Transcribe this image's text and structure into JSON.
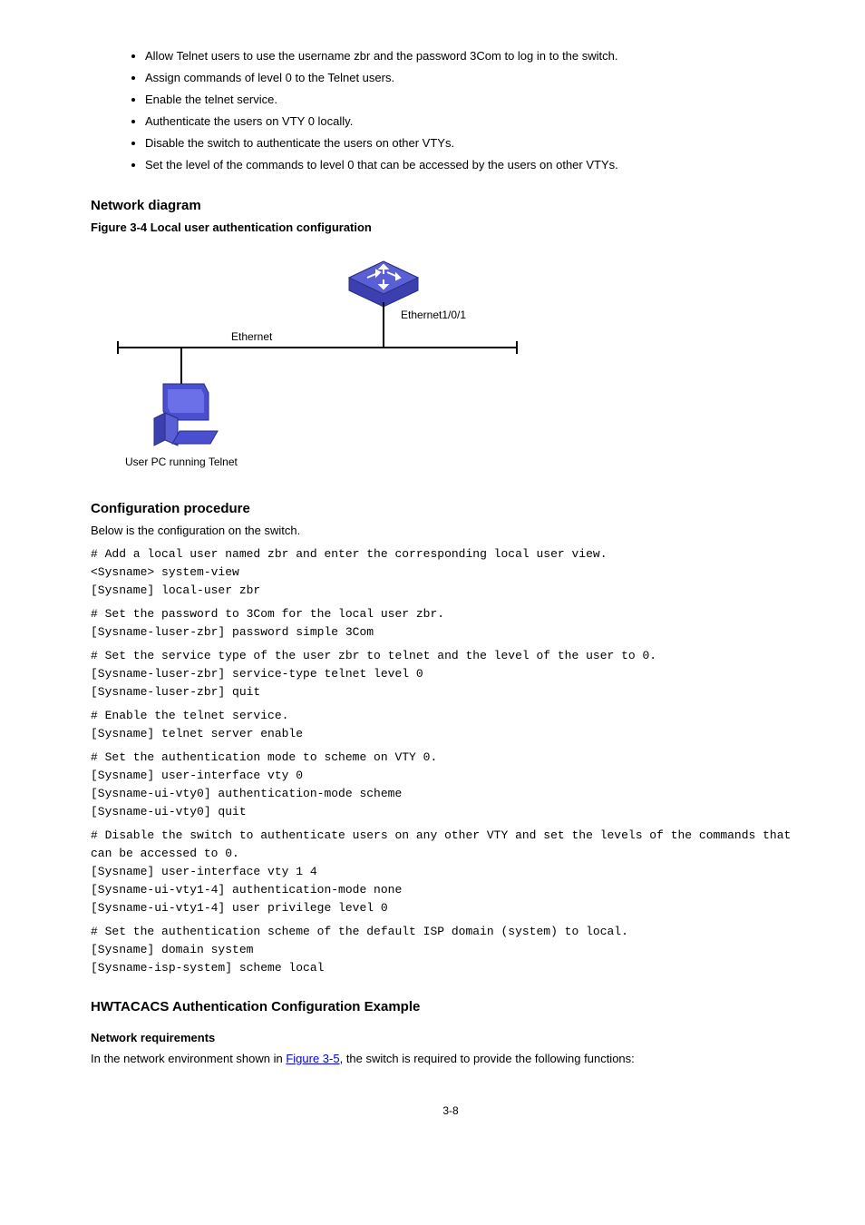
{
  "bullets": [
    "Allow Telnet users to use the username zbr and the password 3Com to log in to the switch.",
    "Assign commands of level 0 to the Telnet users.",
    "Enable the telnet service.",
    "Authenticate the users on VTY 0 locally.",
    "Disable the switch to authenticate the users on other VTYs.",
    "Set the level of the commands to level 0 that can be accessed by the users on other VTYs."
  ],
  "figure_caption": "Figure 3-4 Local user authentication configuration",
  "diagram": {
    "eth_port": "Ethernet1/0/1",
    "eth_label": "Ethernet",
    "pc_label": "User PC running Telnet"
  },
  "section_procedure": "Configuration procedure",
  "procedure_intro": "Below is the configuration on the switch.",
  "cmds": [
    {
      "comment": "# Add a local user named zbr and enter the corresponding local user view.",
      "lines": [
        "<Sysname> system-view",
        "[Sysname] local-user zbr"
      ]
    },
    {
      "comment": "# Set the password to 3Com for the local user zbr.",
      "lines": [
        "[Sysname-luser-zbr] password simple 3Com"
      ]
    },
    {
      "comment": "# Set the service type of the user zbr to telnet and the level of the user to 0.",
      "lines": [
        "[Sysname-luser-zbr] service-type telnet level 0",
        "[Sysname-luser-zbr] quit"
      ]
    },
    {
      "comment": "# Enable the telnet service.",
      "lines": [
        "[Sysname] telnet server enable"
      ]
    },
    {
      "comment": "# Set the authentication mode to scheme on VTY 0.",
      "lines": [
        "[Sysname] user-interface vty 0",
        "[Sysname-ui-vty0] authentication-mode scheme",
        "[Sysname-ui-vty0] quit"
      ]
    },
    {
      "comment": "# Disable the switch to authenticate users on any other VTY and set the levels of the commands that can be accessed to 0.",
      "lines": [
        "[Sysname] user-interface vty 1 4",
        "[Sysname-ui-vty1-4] authentication-mode none",
        "[Sysname-ui-vty1-4] user privilege level 0"
      ]
    },
    {
      "comment": "# Set the authentication scheme of the default ISP domain (system) to local.",
      "lines": [
        "[Sysname] domain system",
        "[Sysname-isp-system] scheme local"
      ]
    }
  ],
  "section_hwtacacs": "HWTACACS Authentication Configuration Example",
  "sub_netreq": "Network requirements",
  "netreq_body_pre": "In the network environment shown in ",
  "netreq_link": "Figure 3-5",
  "netreq_body_post": ", the switch is required to provide the following functions:",
  "page_number": "3-8"
}
